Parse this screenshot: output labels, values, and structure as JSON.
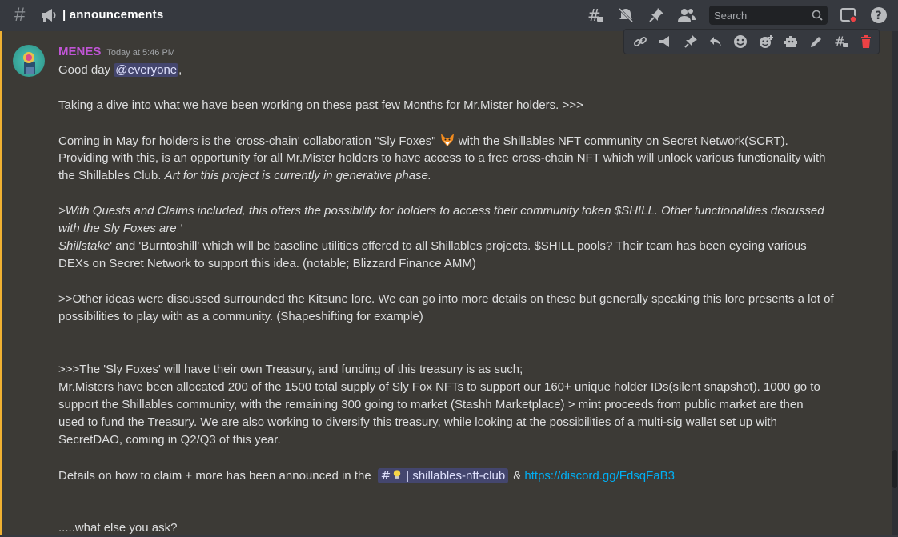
{
  "channel": {
    "name": "| announcements",
    "search_placeholder": "Search"
  },
  "icons": {
    "top": [
      "threads-icon",
      "mute-icon",
      "pin-icon",
      "members-icon",
      "search-icon",
      "inbox-icon",
      "help-icon"
    ],
    "message_toolbar": [
      "link-icon",
      "send-icon",
      "pin-icon",
      "reply-icon",
      "emoji-icon",
      "add-reaction-icon",
      "apps-icon",
      "edit-icon",
      "thread-icon",
      "delete-icon"
    ]
  },
  "colors": {
    "username": "#c155d6",
    "mention_bg": "#4a4e7a",
    "link": "#00aff4",
    "highlight_bar": "#f0b132",
    "delete": "#ed4245"
  },
  "message": {
    "author": "MENES",
    "timestamp": "Today at 5:46 PM",
    "greeting_prefix": "Good day ",
    "mention": "@everyone",
    "greeting_suffix": ",",
    "p1": "Taking a dive into what we have been working on these past few Months for Mr.Mister holders. >>>",
    "p2_line1_a": "Coming in May for holders is the 'cross-chain' collaboration \"Sly Foxes\"",
    "p2_line1_b": " with the Shillables NFT community on Secret Network(SCRT).",
    "p2_line2": "Providing with this, is an opportunity for all Mr.Mister holders to have access to a free cross-chain NFT which will unlock various functionality with",
    "p2_line3_a": "the Shillables Club.  ",
    "p2_line3_b": "Art for this project is currently in generative phase.",
    "p3_line1": ">With Quests and Claims included, this offers the possibility for holders to access their community token $SHILL. Other functionalities discussed",
    "p3_line2": "with the Sly Foxes are '",
    "p3_line3_a": "Shillstake",
    "p3_line3_b": "' and 'Burntoshill' which will be baseline utilities offered to all Shillables projects. $SHILL pools? Their team has been eyeing various",
    "p3_line4": "DEXs on Secret Network to support this idea. (notable; Blizzard Finance AMM)",
    "p4_line1": ">>Other ideas were discussed surrounded the Kitsune lore.  We can go into more details on these but generally speaking this lore presents a lot of",
    "p4_line2": "possibilities to play with as a community. (Shapeshifting for example)",
    "p5_line1": ">>>The 'Sly Foxes' will have their own Treasury, and funding of this treasury is as such;",
    "p5_line2": "Mr.Misters have been allocated 200 of the 1500 total supply of Sly Fox NFTs to support our 160+ unique holder IDs(silent snapshot).  1000 go to",
    "p5_line3": "support the Shillables community, with the remaining 300 going to market (Stashh Marketplace) > mint proceeds from public market are then",
    "p5_line4": "used to fund the Treasury.  We are also working to diversify this treasury, while looking at the possibilities of a multi-sig wallet set up with",
    "p5_line5": "SecretDAO, coming in Q2/Q3 of this year.",
    "p6_prefix": "Details on how to claim + more has been announced in the",
    "channel_mention": "| shillables-nft-club",
    "p6_amp": "& ",
    "p6_link": "https://discord.gg/FdsqFaB3",
    "p7": ".....what else you ask?"
  }
}
